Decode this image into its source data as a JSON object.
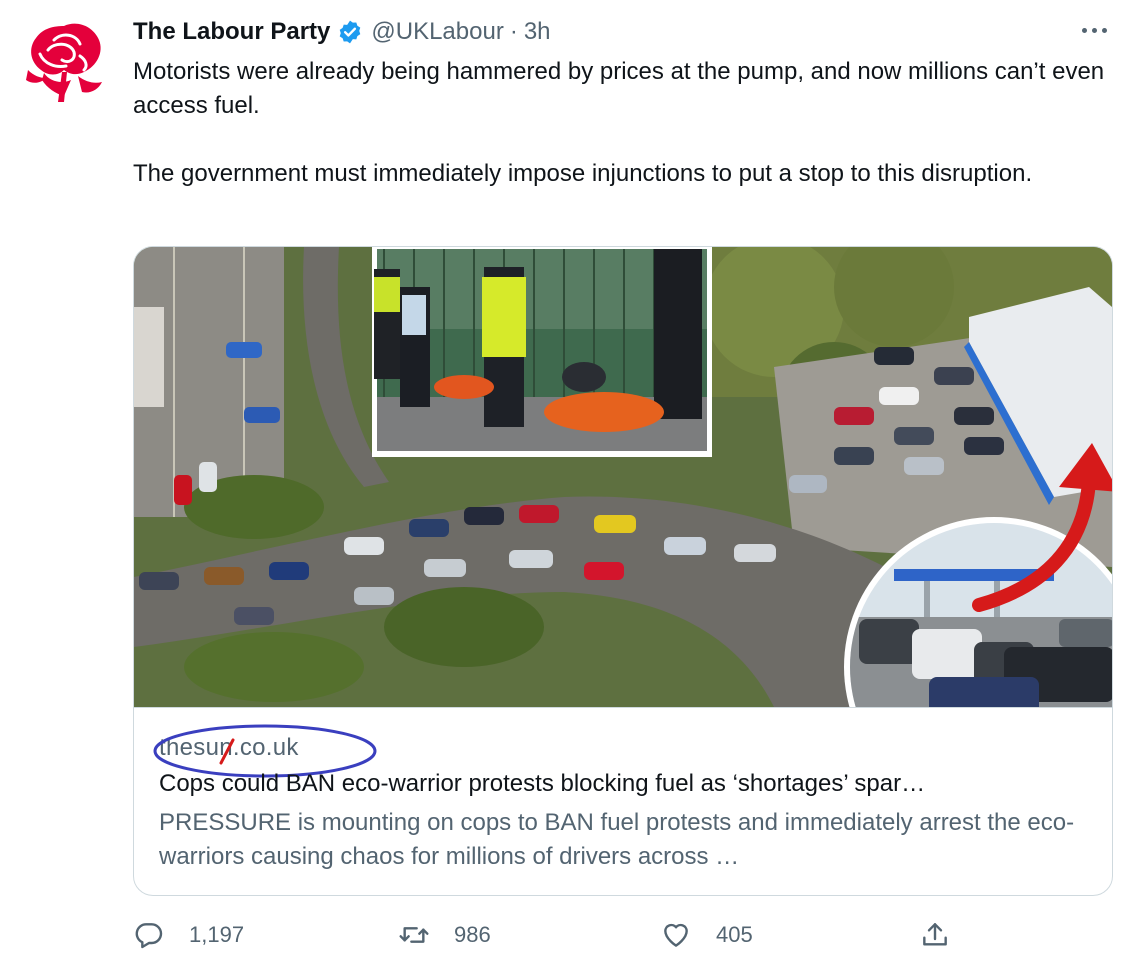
{
  "tweet": {
    "author_name": "The Labour Party",
    "handle": "@UKLabour",
    "separator": "·",
    "time": "3h",
    "text_p1": "Motorists were already being hammered by prices at the pump, and now millions can’t even access fuel.",
    "text_p2": "The government must immediately impose injunctions to put a stop to this disruption."
  },
  "card": {
    "domain": "thesun.co.uk",
    "title": "Cops could BAN eco-warrior protests blocking fuel as ‘shortages’ spar…",
    "description": "PRESSURE is mounting on cops to BAN fuel protests and immediately arrest the eco-warriors causing chaos for millions of drivers across …"
  },
  "actions": {
    "replies": "1,197",
    "retweets": "986",
    "likes": "405"
  },
  "icons": {
    "avatar": "red-rose-logo",
    "verified": "verified-badge-icon",
    "more": "more-dots-icon",
    "reply": "reply-icon",
    "retweet": "retweet-icon",
    "like": "heart-icon",
    "share": "share-icon"
  },
  "colors": {
    "labour_red": "#e4003b",
    "verified_blue": "#1d9bf0",
    "annotation_blue": "#3a3fbf",
    "annotation_red": "#d61a1a",
    "secondary_text": "#536471"
  }
}
